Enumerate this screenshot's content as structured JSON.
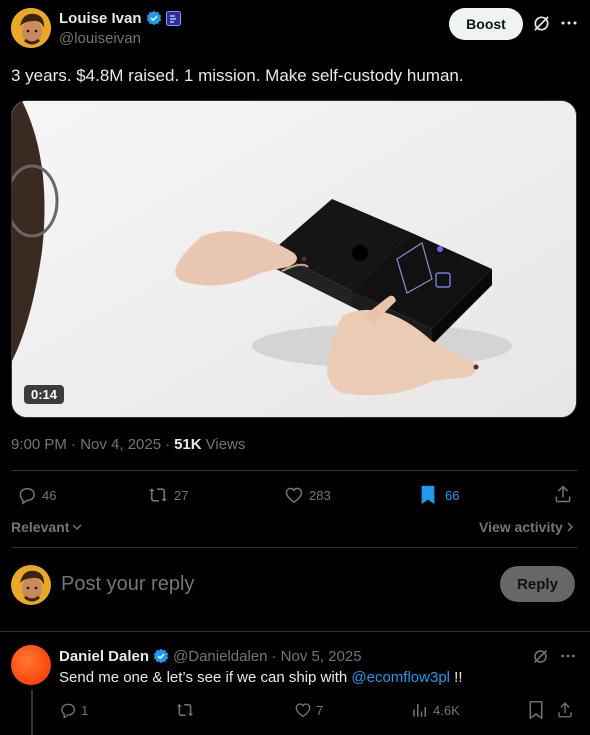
{
  "post": {
    "author_name": "Louise Ivan",
    "author_handle": "@louiseivan",
    "boost_label": "Boost",
    "text": "3 years. $4.8M raised. 1 mission. Make self-custody human.",
    "video_duration": "0:14",
    "timestamp": "9:00 PM · Nov 4, 2025",
    "separator": "·",
    "views_count": "51K",
    "views_label": "Views",
    "stats": {
      "replies": "46",
      "reposts": "27",
      "likes": "283",
      "bookmarks": "66"
    },
    "filter_label": "Relevant",
    "view_activity_label": "View activity"
  },
  "composer": {
    "placeholder": "Post your reply",
    "reply_button": "Reply"
  },
  "reply": {
    "author_name": "Daniel Dalen",
    "author_handle": "@Danieldalen",
    "date": "· Nov 5, 2025",
    "text_before": "Send me one & let’s see if we can ship with ",
    "mention": "@ecomflow3pl",
    "text_after": " !!",
    "stats": {
      "replies": "1",
      "likes": "7",
      "views": "4.6K"
    }
  },
  "colors": {
    "accent": "#1d9bf0",
    "muted": "#71767b",
    "divider": "#2f3336",
    "bookmark_active": "#1d9bf0",
    "reply_avatar": "#ff5a1f"
  },
  "icons": [
    "verified-badge-icon",
    "affiliate-badge-icon",
    "grok-icon",
    "more-icon",
    "reply-icon",
    "repost-icon",
    "like-icon",
    "bookmark-icon",
    "share-icon",
    "chevron-down-icon",
    "chevron-right-icon",
    "views-icon"
  ]
}
